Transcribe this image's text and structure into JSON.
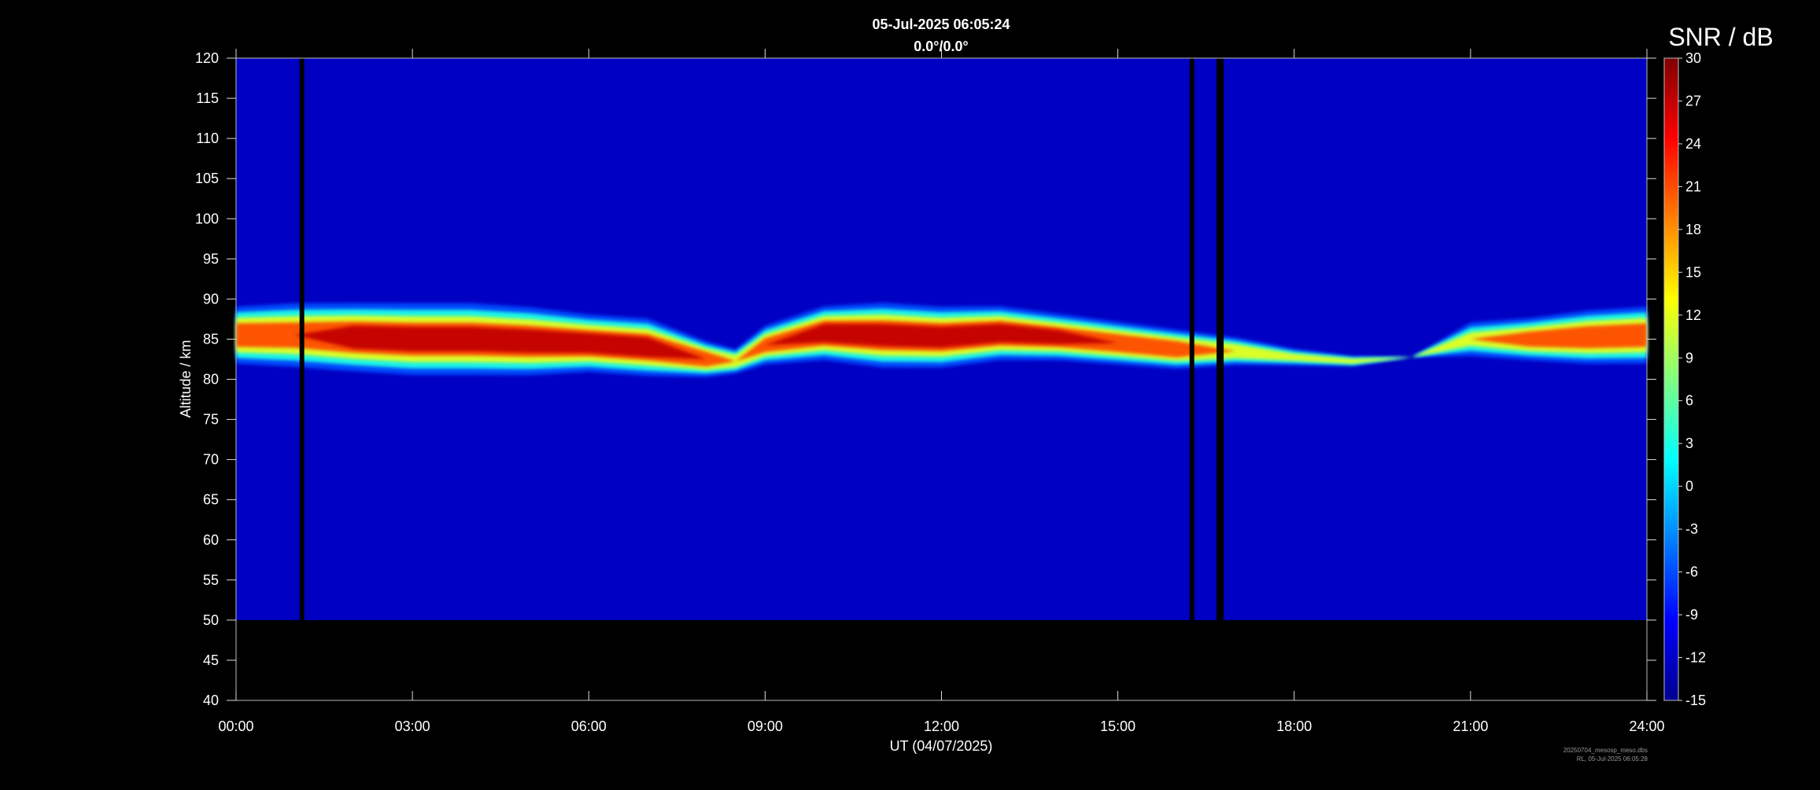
{
  "header": {
    "timestamp": "05-Jul-2025 06:05:24",
    "direction": "0.0°/0.0°"
  },
  "footer": {
    "file_line": "20250704_mesosp_meso.dbs",
    "created_line": "RL, 05-Jul-2025 06:05:28"
  },
  "chart_data": {
    "type": "heatmap",
    "title": "05-Jul-2025 06:05:24",
    "subtitle": "0.0°/0.0°",
    "xlabel": "UT (04/07/2025)",
    "ylabel": "Altitude / km",
    "xlim": [
      0,
      24
    ],
    "ylim": [
      40,
      120
    ],
    "x_ticks": [
      "00:00",
      "03:00",
      "06:00",
      "09:00",
      "12:00",
      "15:00",
      "18:00",
      "21:00",
      "24:00"
    ],
    "y_ticks": [
      40,
      45,
      50,
      55,
      60,
      65,
      70,
      75,
      80,
      85,
      90,
      95,
      100,
      105,
      110,
      115,
      120
    ],
    "grid": false,
    "data_altitude_range": [
      50,
      120
    ],
    "background_snr": -12,
    "data_gaps_hours": [
      [
        1.08,
        1.16
      ],
      [
        16.22,
        16.3
      ],
      [
        16.68,
        16.8
      ]
    ],
    "colorbar": {
      "label": "SNR / dB",
      "range": [
        -15,
        30
      ],
      "ticks": [
        -15,
        -12,
        -9,
        -6,
        -3,
        0,
        3,
        6,
        9,
        12,
        15,
        18,
        21,
        24,
        27,
        30
      ],
      "colormap": "jet"
    },
    "echo_layer": [
      {
        "t": 0.0,
        "bottom": 81.5,
        "top": 89.5,
        "peak_snr": 27
      },
      {
        "t": 1.0,
        "bottom": 81.0,
        "top": 90.0,
        "peak_snr": 26
      },
      {
        "t": 2.0,
        "bottom": 80.5,
        "top": 90.0,
        "peak_snr": 30
      },
      {
        "t": 3.0,
        "bottom": 80.0,
        "top": 90.0,
        "peak_snr": 30
      },
      {
        "t": 4.0,
        "bottom": 80.0,
        "top": 90.0,
        "peak_snr": 30
      },
      {
        "t": 5.0,
        "bottom": 80.0,
        "top": 89.5,
        "peak_snr": 30
      },
      {
        "t": 6.0,
        "bottom": 80.5,
        "top": 88.5,
        "peak_snr": 30
      },
      {
        "t": 7.0,
        "bottom": 80.0,
        "top": 88.0,
        "peak_snr": 30
      },
      {
        "t": 8.0,
        "bottom": 80.0,
        "top": 85.0,
        "peak_snr": 27
      },
      {
        "t": 8.5,
        "bottom": 80.5,
        "top": 84.0,
        "peak_snr": 20
      },
      {
        "t": 9.0,
        "bottom": 81.5,
        "top": 87.0,
        "peak_snr": 24
      },
      {
        "t": 10.0,
        "bottom": 82.0,
        "top": 89.5,
        "peak_snr": 30
      },
      {
        "t": 11.0,
        "bottom": 81.0,
        "top": 90.0,
        "peak_snr": 30
      },
      {
        "t": 12.0,
        "bottom": 81.0,
        "top": 89.5,
        "peak_snr": 30
      },
      {
        "t": 13.0,
        "bottom": 82.0,
        "top": 89.5,
        "peak_snr": 30
      },
      {
        "t": 14.0,
        "bottom": 82.0,
        "top": 88.5,
        "peak_snr": 28
      },
      {
        "t": 15.0,
        "bottom": 81.5,
        "top": 87.5,
        "peak_snr": 27
      },
      {
        "t": 16.0,
        "bottom": 81.0,
        "top": 86.5,
        "peak_snr": 27
      },
      {
        "t": 17.0,
        "bottom": 81.5,
        "top": 85.5,
        "peak_snr": 20
      },
      {
        "t": 18.0,
        "bottom": 81.5,
        "top": 84.0,
        "peak_snr": 15
      },
      {
        "t": 19.0,
        "bottom": 81.5,
        "top": 83.0,
        "peak_snr": 18
      },
      {
        "t": 20.0,
        "bottom": 82.5,
        "top": 83.0,
        "peak_snr": -6
      },
      {
        "t": 21.0,
        "bottom": 82.5,
        "top": 87.5,
        "peak_snr": 15
      },
      {
        "t": 22.0,
        "bottom": 82.0,
        "top": 88.0,
        "peak_snr": 24
      },
      {
        "t": 23.0,
        "bottom": 81.5,
        "top": 89.0,
        "peak_snr": 27
      },
      {
        "t": 24.0,
        "bottom": 81.5,
        "top": 89.5,
        "peak_snr": 27
      }
    ]
  }
}
